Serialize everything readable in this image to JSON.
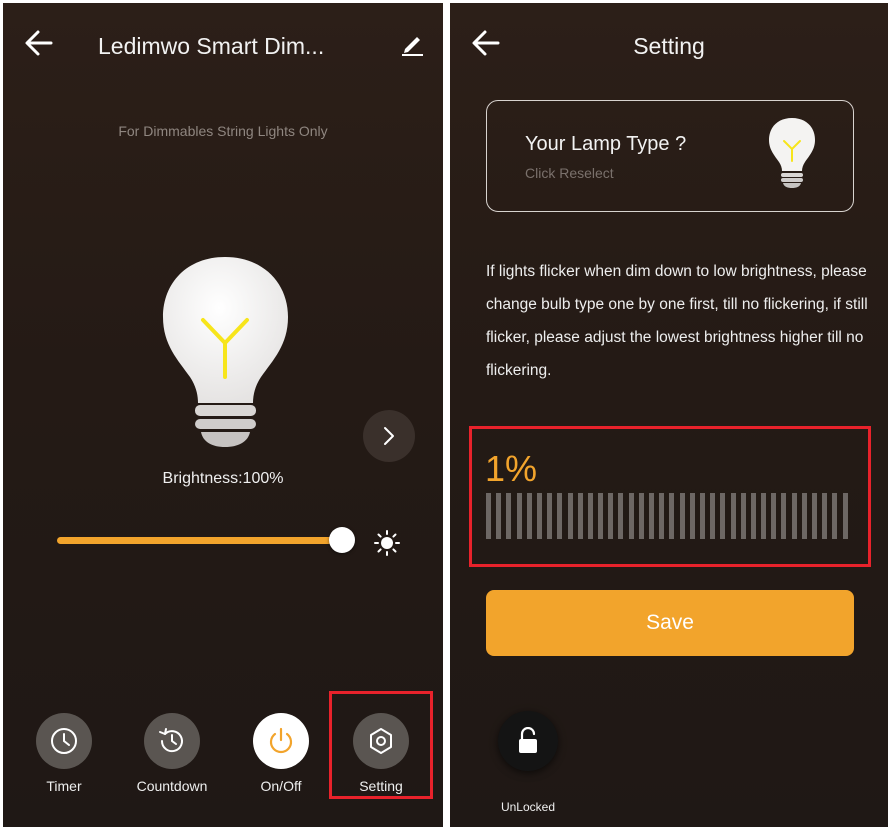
{
  "left_screen": {
    "title": "Ledimwo Smart Dim...",
    "subtitle": "For Dimmables String Lights Only",
    "bulb_icon": "light-bulb-icon",
    "brightness_label": "Brightness:100%",
    "brightness_value": 100,
    "bottom_nav": [
      {
        "label": "Timer",
        "icon": "clock-icon"
      },
      {
        "label": "Countdown",
        "icon": "countdown-icon"
      },
      {
        "label": "On/Off",
        "icon": "power-icon",
        "active": true
      },
      {
        "label": "Setting",
        "icon": "settings-hexagon-icon",
        "highlighted": true
      }
    ]
  },
  "right_screen": {
    "title": "Setting",
    "lamp_card": {
      "question": "Your Lamp Type ?",
      "subtext": "Click Reselect"
    },
    "info_text": "If lights flicker when dim down to low brightness, please change bulb type one by one first, till no flickering, if still flicker, please adjust the lowest brightness higher till no flickering.",
    "lowest_brightness_label": "1%",
    "lowest_brightness_value": 1,
    "save_label": "Save",
    "lock_label": "UnLocked"
  },
  "colors": {
    "accent": "#f2a42c",
    "highlight": "#e8222b",
    "background": "#2a1e18"
  }
}
